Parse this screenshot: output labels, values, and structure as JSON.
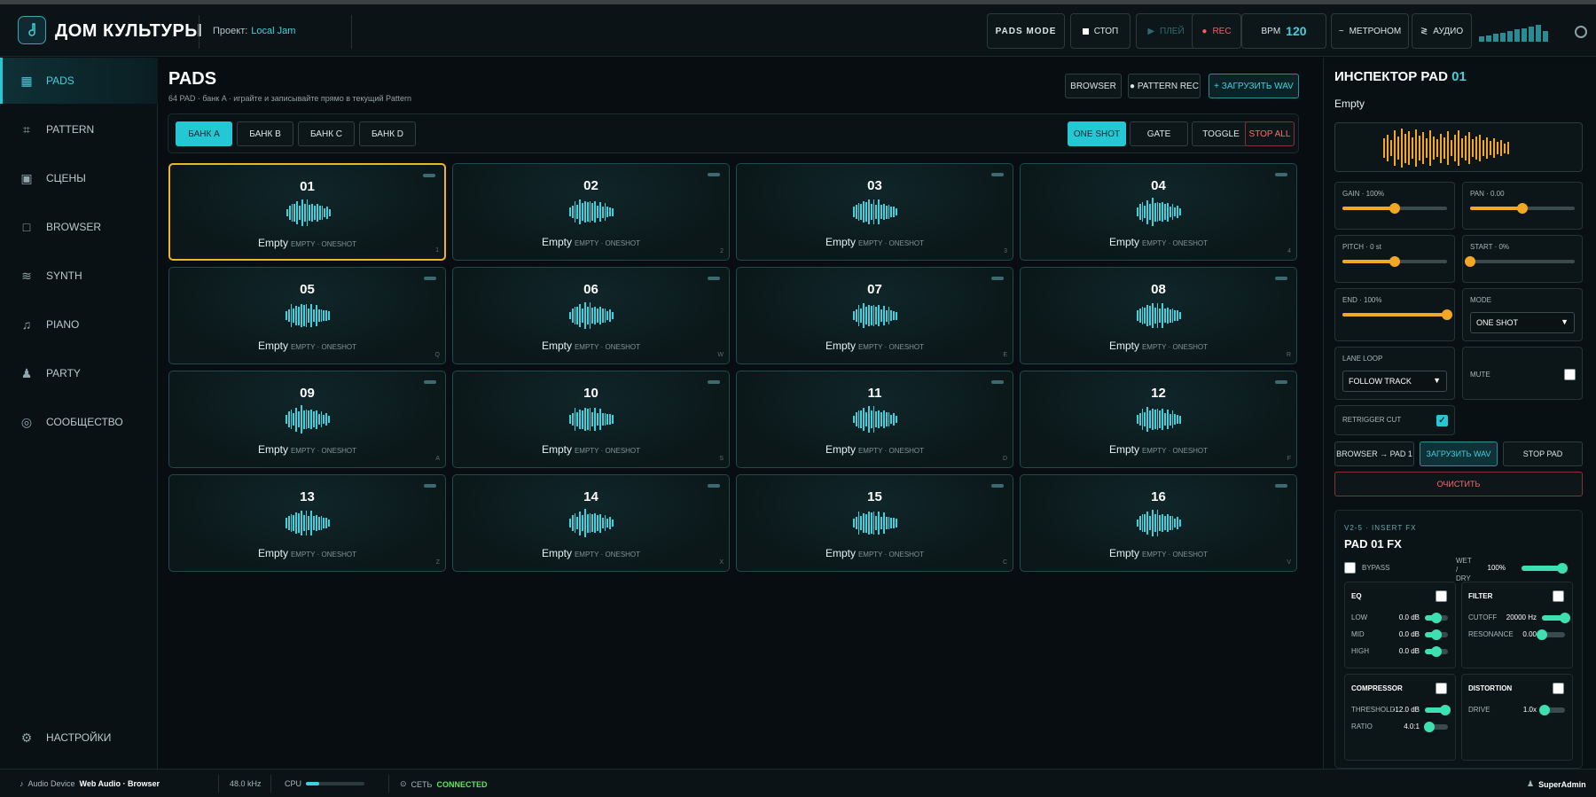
{
  "header": {
    "brand": "ДОМ КУЛЬТУРЫ",
    "project_label": "Проект:",
    "project_name": "Local Jam",
    "pads_mode": "PADS MODE",
    "stop": "СТОП",
    "play": "ПЛЕЙ",
    "rec": "REC",
    "bpm_label": "BPM",
    "bpm_value": "120",
    "metronome": "МЕТРОНОМ",
    "audio": "АУДИО",
    "meter_levels": [
      0.3,
      0.35,
      0.45,
      0.5,
      0.6,
      0.7,
      0.75,
      0.85,
      0.95,
      0.6
    ]
  },
  "sidebar": {
    "items": [
      {
        "label": "PADS",
        "icon": "grid-icon",
        "glyph": "▦",
        "active": true
      },
      {
        "label": "PATTERN",
        "icon": "pattern-icon",
        "glyph": "⌗",
        "active": false
      },
      {
        "label": "СЦЕНЫ",
        "icon": "scenes-icon",
        "glyph": "▣",
        "active": false
      },
      {
        "label": "BROWSER",
        "icon": "browser-icon",
        "glyph": "□",
        "active": false
      },
      {
        "label": "SYNTH",
        "icon": "synth-wave-icon",
        "glyph": "≋",
        "active": false
      },
      {
        "label": "PIANO",
        "icon": "music-note-icon",
        "glyph": "♫",
        "active": false
      },
      {
        "label": "PARTY",
        "icon": "person-icon",
        "glyph": "♟",
        "active": false
      },
      {
        "label": "СООБЩЕСТВО",
        "icon": "community-icon",
        "glyph": "◎",
        "active": false
      }
    ],
    "settings": "НАСТРОЙКИ"
  },
  "main": {
    "title": "PADS",
    "subtitle": "64 PAD · банк A · играйте и записывайте прямо в текущий Pattern",
    "browser_btn": "BROWSER",
    "pattern_rec_btn": "● PATTERN REC",
    "load_wav_btn": "+ ЗАГРУЗИТЬ WAV",
    "banks": [
      "БАНК A",
      "БАНК B",
      "БАНК C",
      "БАНК D"
    ],
    "active_bank": 0,
    "modes": [
      "ONE SHOT",
      "GATE",
      "TOGGLE"
    ],
    "active_mode": 0,
    "stop_all": "STOP ALL",
    "pads": [
      {
        "num": "01",
        "name": "Empty",
        "meta": "EMPTY · ONESHOT",
        "key": "1"
      },
      {
        "num": "02",
        "name": "Empty",
        "meta": "EMPTY · ONESHOT",
        "key": "2"
      },
      {
        "num": "03",
        "name": "Empty",
        "meta": "EMPTY · ONESHOT",
        "key": "3"
      },
      {
        "num": "04",
        "name": "Empty",
        "meta": "EMPTY · ONESHOT",
        "key": "4"
      },
      {
        "num": "05",
        "name": "Empty",
        "meta": "EMPTY · ONESHOT",
        "key": "Q"
      },
      {
        "num": "06",
        "name": "Empty",
        "meta": "EMPTY · ONESHOT",
        "key": "W"
      },
      {
        "num": "07",
        "name": "Empty",
        "meta": "EMPTY · ONESHOT",
        "key": "E"
      },
      {
        "num": "08",
        "name": "Empty",
        "meta": "EMPTY · ONESHOT",
        "key": "R"
      },
      {
        "num": "09",
        "name": "Empty",
        "meta": "EMPTY · ONESHOT",
        "key": "A"
      },
      {
        "num": "10",
        "name": "Empty",
        "meta": "EMPTY · ONESHOT",
        "key": "S"
      },
      {
        "num": "11",
        "name": "Empty",
        "meta": "EMPTY · ONESHOT",
        "key": "D"
      },
      {
        "num": "12",
        "name": "Empty",
        "meta": "EMPTY · ONESHOT",
        "key": "F"
      },
      {
        "num": "13",
        "name": "Empty",
        "meta": "EMPTY · ONESHOT",
        "key": "Z"
      },
      {
        "num": "14",
        "name": "Empty",
        "meta": "EMPTY · ONESHOT",
        "key": "X"
      },
      {
        "num": "15",
        "name": "Empty",
        "meta": "EMPTY · ONESHOT",
        "key": "C"
      },
      {
        "num": "16",
        "name": "Empty",
        "meta": "EMPTY · ONESHOT",
        "key": "V"
      }
    ],
    "selected_pad": 0
  },
  "inspector": {
    "title": "ИНСПЕКТОР PAD",
    "pad_num": "01",
    "sample_name": "Empty",
    "gain_label": "GAIN · 100%",
    "gain_value": 0.5,
    "pan_label": "PAN · 0.00",
    "pan_value": 0.5,
    "pitch_label": "PITCH · 0 st",
    "pitch_value": 0.5,
    "start_label": "START · 0%",
    "start_value": 0,
    "end_label": "END · 100%",
    "end_value": 1,
    "mode_label": "MODE",
    "mode_value": "ONE SHOT",
    "lane_loop_label": "LANE LOOP",
    "lane_loop_value": "FOLLOW TRACK",
    "mute_label": "MUTE",
    "mute_checked": false,
    "retrigger_label": "RETRIGGER CUT",
    "retrigger_checked": true,
    "browser_to_pad": "BROWSER → PAD 1",
    "load_wav": "ЗАГРУЗИТЬ WAV",
    "stop_pad": "STOP PAD",
    "clear": "ОЧИСТИТЬ",
    "fx": {
      "tag": "V2-5 · INSERT FX",
      "title": "PAD 01 FX",
      "bypass_label": "BYPASS",
      "wetdry_label": "WET / DRY",
      "wetdry_value": "100%",
      "wetdry_level": 1,
      "eq": {
        "title": "EQ",
        "rows": [
          {
            "label": "LOW",
            "value": "0.0 dB",
            "level": 0.5
          },
          {
            "label": "MID",
            "value": "0.0 dB",
            "level": 0.5
          },
          {
            "label": "HIGH",
            "value": "0.0 dB",
            "level": 0.5
          }
        ]
      },
      "filter": {
        "title": "FILTER",
        "rows": [
          {
            "label": "CUTOFF",
            "value": "20000 Hz",
            "level": 1
          },
          {
            "label": "RESONANCE",
            "value": "0.00",
            "level": 0
          }
        ]
      },
      "compressor": {
        "title": "COMPRESSOR",
        "rows": [
          {
            "label": "THRESHOLD",
            "value": "-12.0 dB",
            "level": 0.9
          },
          {
            "label": "RATIO",
            "value": "4.0:1",
            "level": 0.2
          }
        ]
      },
      "distortion": {
        "title": "DISTORTION",
        "rows": [
          {
            "label": "DRIVE",
            "value": "1.0x",
            "level": 0.1
          }
        ]
      }
    }
  },
  "statusbar": {
    "device_label": "Audio Device",
    "device_value": "Web Audio · Browser",
    "sample_rate": "48.0 kHz",
    "cpu_label": "CPU",
    "cpu_level": 0.22,
    "net_label": "СЕТЬ",
    "net_status": "CONNECTED",
    "user": "SuperAdmin"
  },
  "colors": {
    "accent": "#29c6d3",
    "selection": "#f0b429",
    "slider": "#f5a623",
    "fx_slider": "#3de0b0",
    "danger": "#ff6a70",
    "ok": "#5ee35e"
  }
}
